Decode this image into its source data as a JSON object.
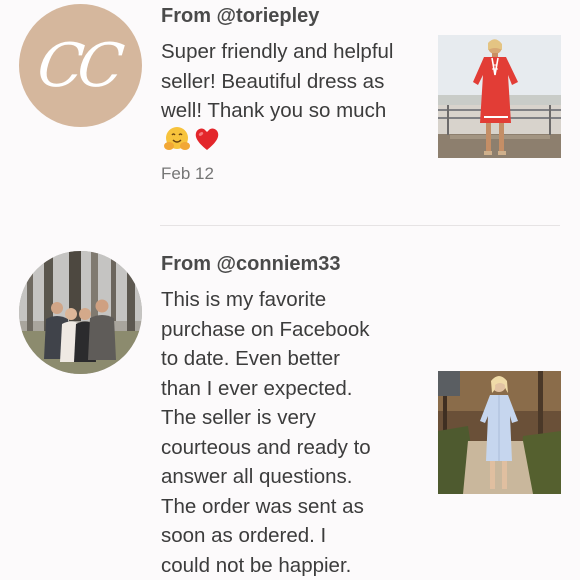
{
  "reviews": [
    {
      "author": "From @toriepley",
      "avatar_initials": "CC",
      "body": "Super friendly and helpful seller! Beautiful dress as well! Thank you so much",
      "emojis": [
        "hugging-face",
        "red-heart"
      ],
      "date": "Feb 12",
      "photo": "woman in red embroidered tunic dress on a pier"
    },
    {
      "author": "From @conniem33",
      "avatar": "group photo of four people in woods",
      "body_lines": [
        "This is my favorite",
        "purchase on Facebook",
        "to date. Even better",
        "than I ever expected.",
        "The seller is very",
        "courteous and ready to",
        "answer all questions.",
        "The order was sent as",
        "soon as ordered. I",
        "could not be happier."
      ],
      "photo": "woman in light blue shirt dress on sandy path"
    }
  ],
  "colors": {
    "background": "#fcfafb",
    "avatar_tan": "#d5b79d",
    "divider": "#e6e3e4",
    "text": "#3c3c3c",
    "muted": "#757575"
  }
}
